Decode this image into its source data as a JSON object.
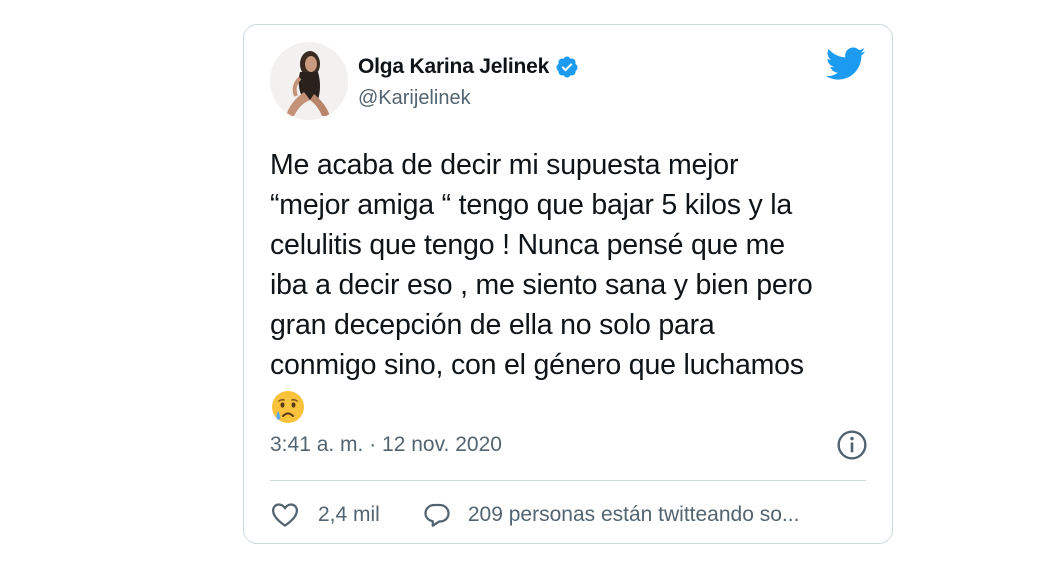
{
  "tweet": {
    "author": {
      "display_name": "Olga Karina Jelinek",
      "handle": "@Karijelinek",
      "verified": true
    },
    "text_lines": [
      "Me acaba de decir mi supuesta mejor",
      "“mejor amiga “ tengo que bajar 5 kilos y la",
      "celulitis que tengo ! Nunca pensé que me",
      "iba a decir eso , me siento sana y bien pero",
      "gran decepción de ella no solo para",
      "conmigo sino, con el género que luchamos"
    ],
    "emoji": "crying-face",
    "timestamp": "3:41 a. m. · 12 nov. 2020",
    "likes": "2,4 mil",
    "conversation": "209 personas están twitteando so..."
  },
  "colors": {
    "brand": "#1d9bf0",
    "text_primary": "#0f1419",
    "text_secondary": "#536471",
    "border": "#cfd9de"
  }
}
